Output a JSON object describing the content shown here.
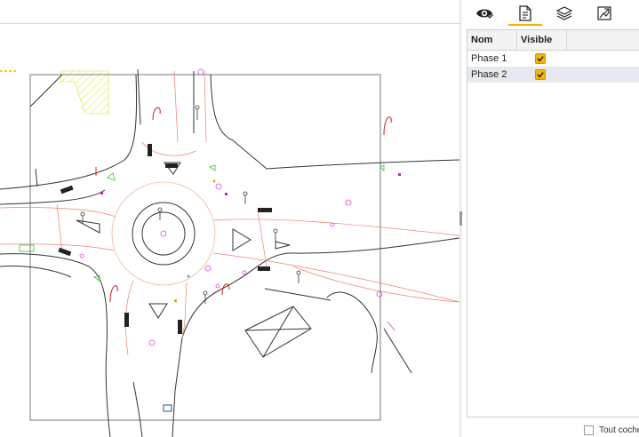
{
  "panel": {
    "tabs": [
      {
        "icon": "eye-check-icon",
        "active": false
      },
      {
        "icon": "document-list-icon",
        "active": true
      },
      {
        "icon": "layers-icon",
        "active": false
      },
      {
        "icon": "image-export-icon",
        "active": false
      }
    ],
    "columns": {
      "name": "Nom",
      "visible": "Visible"
    },
    "rows": [
      {
        "name": "Phase 1",
        "visible": true,
        "selected": false
      },
      {
        "name": "Phase 2",
        "visible": true,
        "selected": true
      }
    ],
    "footer": {
      "check_all_label": "Tout cocher",
      "checked": false
    }
  },
  "colors": {
    "accent": "#f5b700",
    "selection": "#e6eaf0"
  }
}
